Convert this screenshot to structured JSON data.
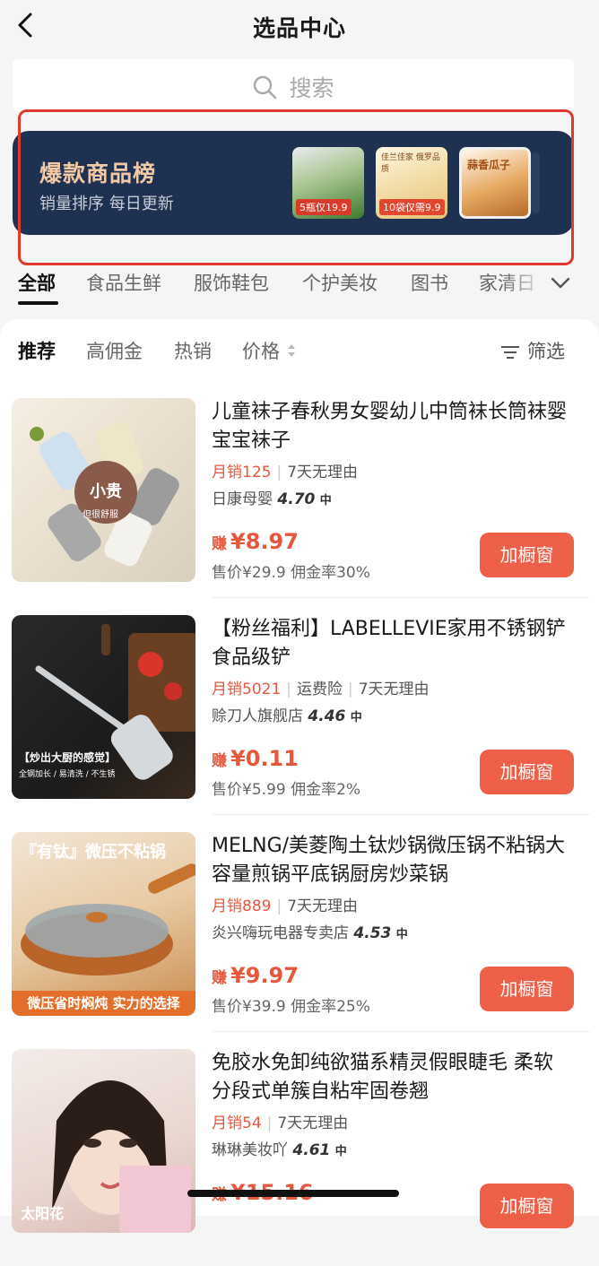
{
  "header": {
    "title": "选品中心"
  },
  "search": {
    "placeholder": "搜索"
  },
  "banner": {
    "title": "爆款商品榜",
    "subtitle": "销量排序 每日更新",
    "thumbs": [
      {
        "tag": "5瓶仅19.9"
      },
      {
        "top": "佳兰佳家 俄罗品质",
        "tag": "10袋仅需9.9"
      },
      {
        "label": "蒜香瓜子"
      }
    ]
  },
  "categories": [
    "全部",
    "食品生鲜",
    "服饰鞋包",
    "个护美妆",
    "图书",
    "家清日"
  ],
  "sort": {
    "items": [
      "推荐",
      "高佣金",
      "热销",
      "价格"
    ],
    "filter": "筛选"
  },
  "products": [
    {
      "title": "儿童袜子春秋男女婴幼儿中筒袜长筒袜婴宝宝袜子",
      "sales": "月销125",
      "tags": [
        "7天无理由"
      ],
      "shop": "日康母婴",
      "score": "4.70",
      "level": "中",
      "earn_label": "赚",
      "earn": "¥8.97",
      "price_line": "售价¥29.9 佣金率30%",
      "button": "加橱窗",
      "badge": "小贵",
      "badge_sub": "但很舒服"
    },
    {
      "title": "【粉丝福利】LABELLEVIE家用不锈钢铲食品级铲",
      "sales": "月销5021",
      "tags": [
        "运费险",
        "7天无理由"
      ],
      "shop": "赊刀人旗舰店",
      "score": "4.46",
      "level": "中",
      "earn_label": "赚",
      "earn": "¥0.11",
      "price_line": "售价¥5.99 佣金率2%",
      "button": "加橱窗",
      "caption": "【炒出大厨的感觉】",
      "caption2": "全钢加长 / 易清洗 / 不生锈"
    },
    {
      "title": "MELNG/美菱陶土钛炒锅微压锅不粘锅大容量煎锅平底锅厨房炒菜锅",
      "sales": "月销889",
      "tags": [
        "7天无理由"
      ],
      "shop": "炎兴嗨玩电器专卖店",
      "score": "4.53",
      "level": "中",
      "earn_label": "赚",
      "earn": "¥9.97",
      "price_line": "售价¥39.9 佣金率25%",
      "button": "加橱窗",
      "img_title": "『有钛』微压不粘锅",
      "caption": "微压省时焖炖 实力的选择"
    },
    {
      "title": "免胶水免卸纯欲猫系精灵假眼睫毛 柔软分段式单簇自粘牢固卷翘",
      "sales": "月销54",
      "tags": [
        "7天无理由"
      ],
      "shop": "琳琳美妆吖",
      "score": "4.61",
      "level": "中",
      "earn_label": "赚",
      "earn": "¥15.16",
      "price_line": "",
      "button": "加橱窗",
      "img_title": "太阳花"
    }
  ]
}
